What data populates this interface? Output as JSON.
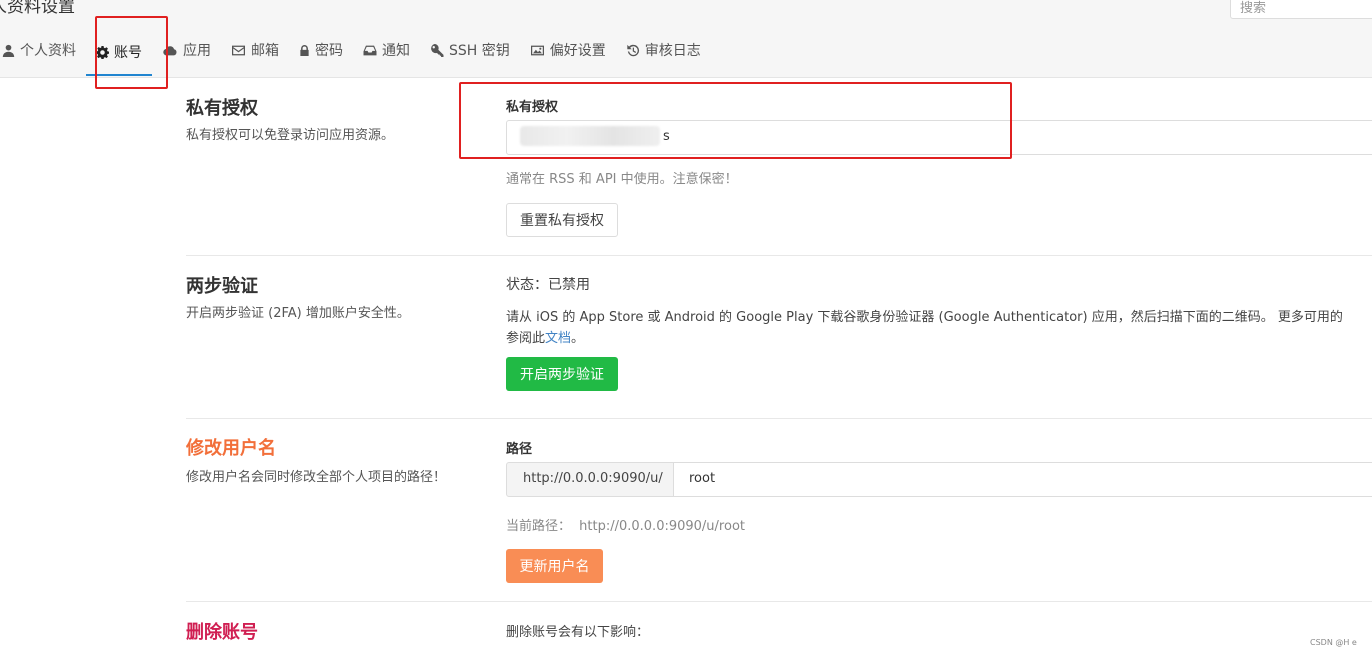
{
  "header": {
    "title": "人资料设置",
    "search_placeholder": "搜索"
  },
  "tabs": [
    {
      "label": "个人资料",
      "icon": "user-icon"
    },
    {
      "label": "账号",
      "icon": "gear-icon",
      "active": true
    },
    {
      "label": "应用",
      "icon": "cloud-icon"
    },
    {
      "label": "邮箱",
      "icon": "envelope-icon"
    },
    {
      "label": "密码",
      "icon": "lock-icon"
    },
    {
      "label": "通知",
      "icon": "inbox-icon"
    },
    {
      "label": "SSH 密钥",
      "icon": "key-icon"
    },
    {
      "label": "偏好设置",
      "icon": "image-icon"
    },
    {
      "label": "审核日志",
      "icon": "history-icon"
    }
  ],
  "private_token": {
    "title": "私有授权",
    "description": "私有授权可以免登录访问应用资源。",
    "field_label": "私有授权",
    "value_suffix": "s",
    "hint": "通常在 RSS 和 API 中使用。注意保密！",
    "reset_button": "重置私有授权"
  },
  "two_factor": {
    "title": "两步验证",
    "description": "开启两步验证 (2FA) 增加账户安全性。",
    "status": "状态：已禁用",
    "instructions": "请从 iOS 的 App Store 或 Android 的 Google Play 下载谷歌身份验证器 (Google Authenticator) 应用，然后扫描下面的二维码。 更多可用的",
    "docs_prefix": "参阅此",
    "docs_link": "文档",
    "docs_suffix": "。",
    "enable_button": "开启两步验证"
  },
  "username": {
    "title": "修改用户名",
    "description": "修改用户名会同时修改全部个人项目的路径！",
    "field_label": "路径",
    "url_prefix": "http://0.0.0.0:9090/u/",
    "value": "root",
    "current_path_label": "当前路径：",
    "current_path": "http://0.0.0.0:9090/u/root",
    "update_button": "更新用户名"
  },
  "delete_account": {
    "title": "删除账号",
    "impact_text": "删除账号会有以下影响："
  },
  "watermark": "CSDN @H e",
  "colors": {
    "tab_underline": "#2185d0",
    "highlight_box": "#e02020",
    "green_button": "#21ba45",
    "orange_button": "#f2711c",
    "orange_title": "#f26f3a",
    "danger_title": "#db2828",
    "link": "#4183c4"
  }
}
